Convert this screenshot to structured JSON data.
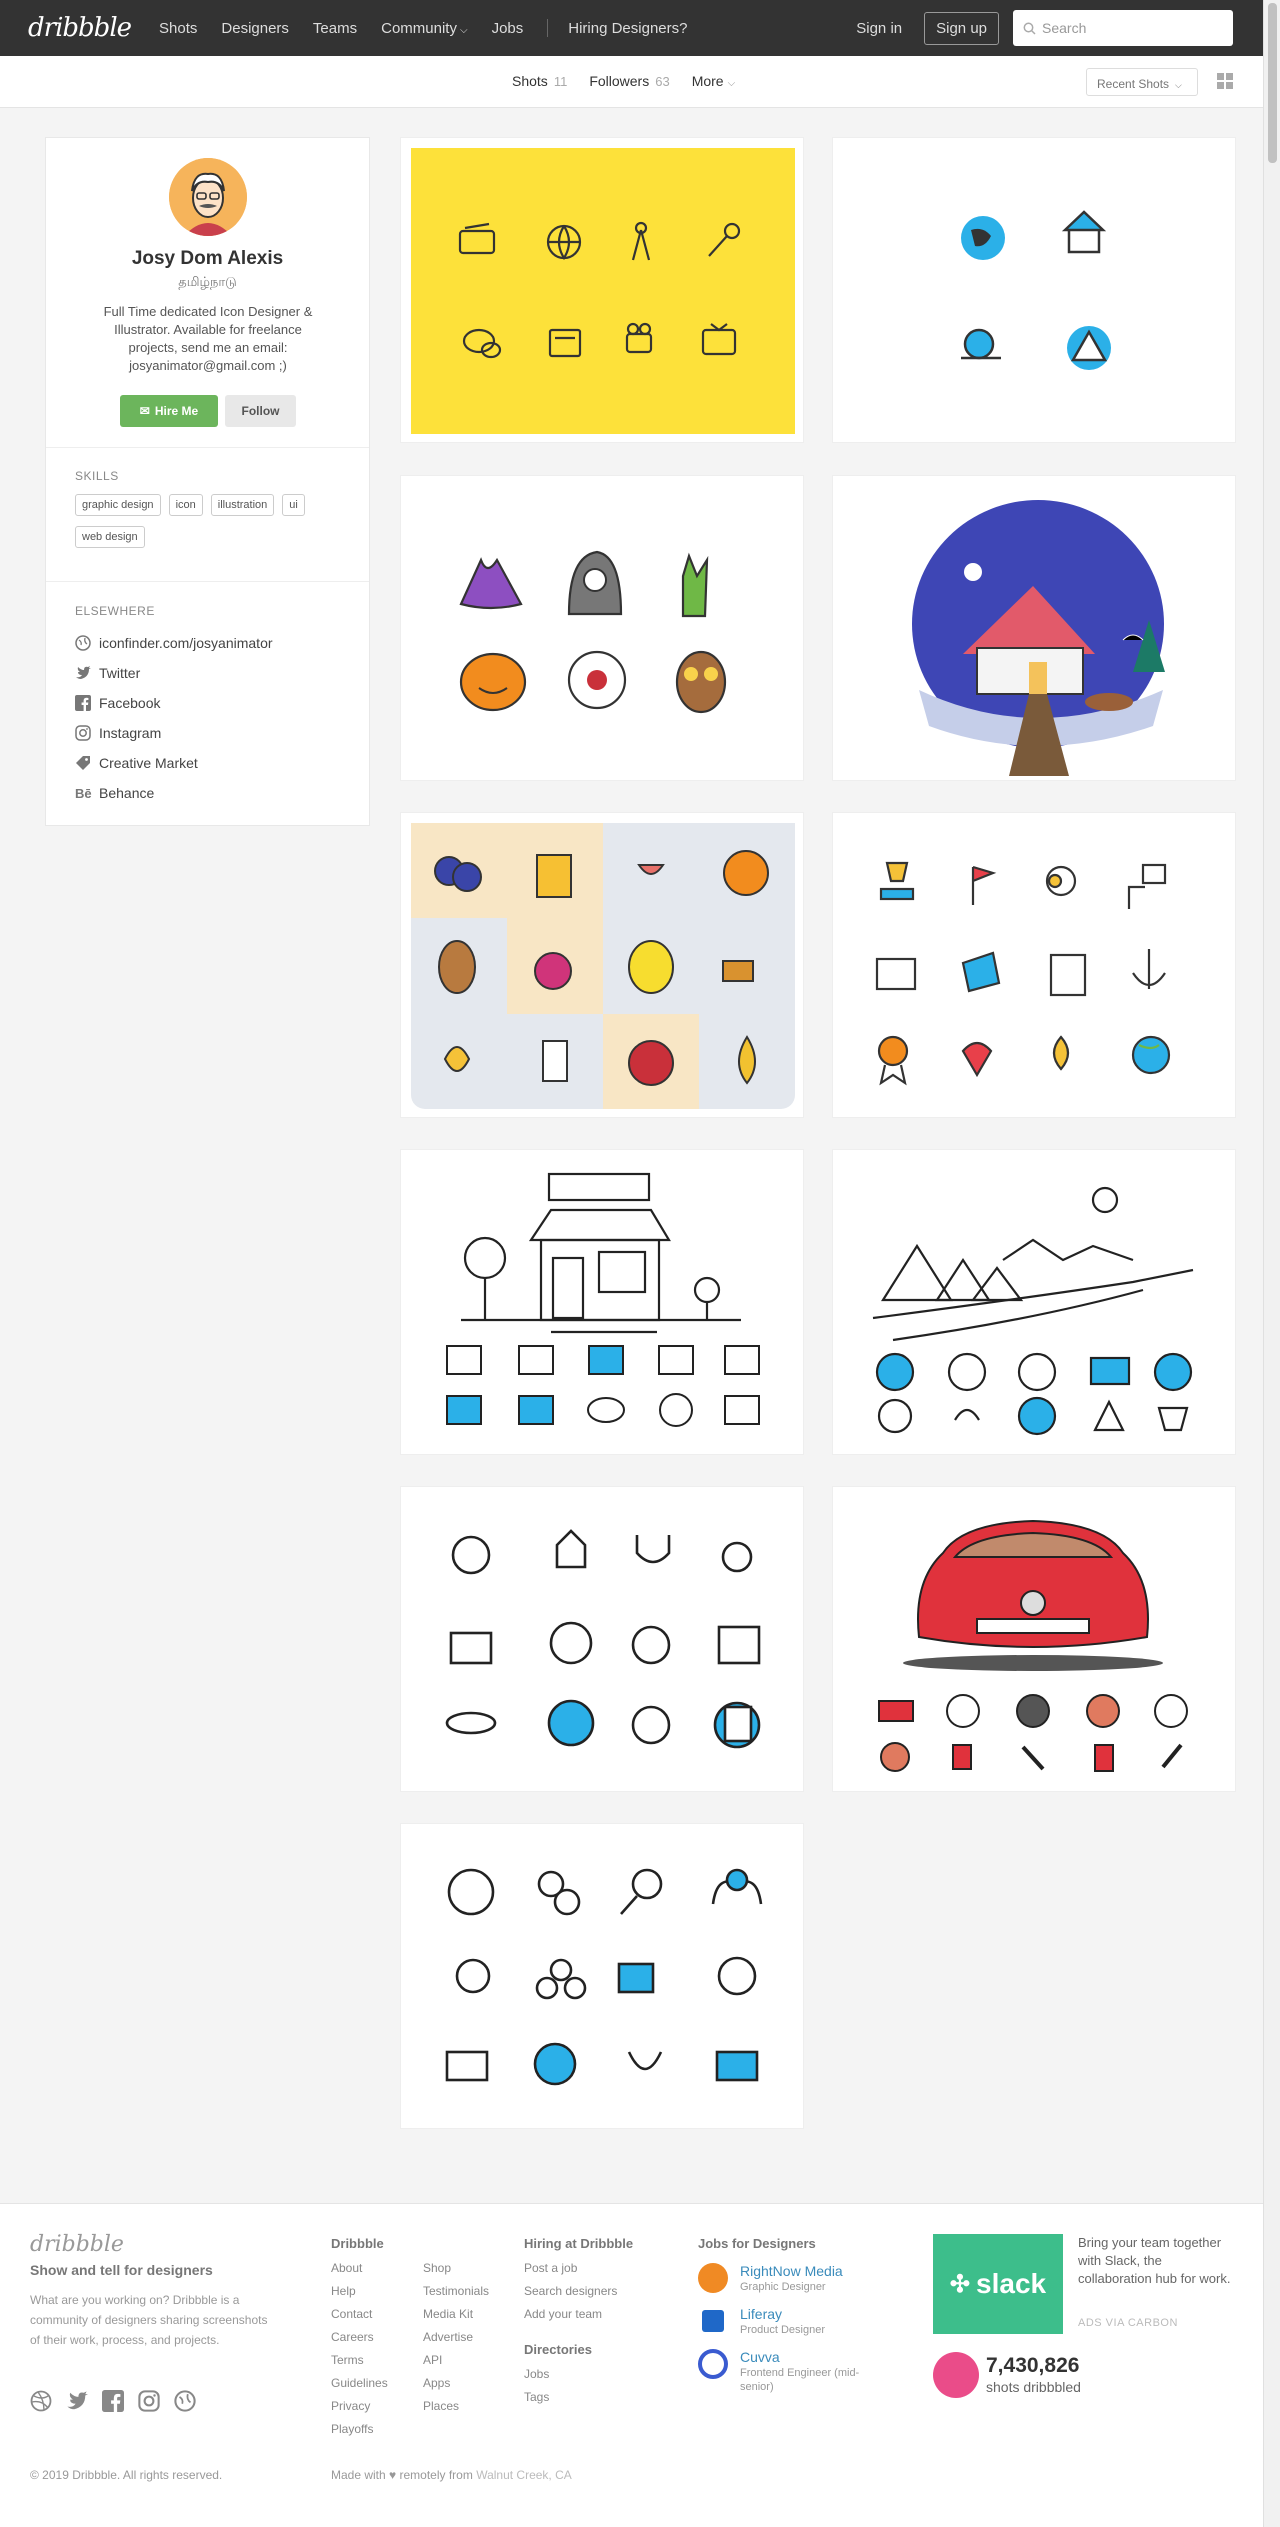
{
  "header": {
    "logo": "dribbble",
    "nav": [
      "Shots",
      "Designers",
      "Teams",
      "Community",
      "Jobs"
    ],
    "hiring": "Hiring Designers?",
    "signin": "Sign in",
    "signup": "Sign up",
    "search_placeholder": "Search"
  },
  "subnav": {
    "tabs": [
      {
        "label": "Shots",
        "count": "11"
      },
      {
        "label": "Followers",
        "count": "63"
      },
      {
        "label": "More",
        "count": ""
      }
    ],
    "sort": "Recent Shots"
  },
  "profile": {
    "name": "Josy Dom Alexis",
    "location": "தமிழ்நாடு",
    "bio": "Full Time dedicated Icon Designer & Illustrator. Available for freelance projects, send me an email: josyanimator@gmail.com ;)",
    "hire": "Hire Me",
    "follow": "Follow",
    "skills_heading": "SKILLS",
    "skills": [
      "graphic design",
      "icon",
      "illustration",
      "ui",
      "web design"
    ],
    "elsewhere_heading": "ELSEWHERE",
    "links": [
      {
        "label": "iconfinder.com/josyanimator",
        "icon": "globe-icon"
      },
      {
        "label": "Twitter",
        "icon": "twitter-icon"
      },
      {
        "label": "Facebook",
        "icon": "facebook-icon"
      },
      {
        "label": "Instagram",
        "icon": "instagram-icon"
      },
      {
        "label": "Creative Market",
        "icon": "tag-icon"
      },
      {
        "label": "Behance",
        "icon": "behance-icon"
      }
    ]
  },
  "shots": [
    {
      "name": "media-icons",
      "bg": "#fde13a"
    },
    {
      "name": "nature-icons",
      "bg": "#ffffff"
    },
    {
      "name": "halloween-icons",
      "bg": "#ffffff"
    },
    {
      "name": "winter-house-illustration",
      "bg": "#ffffff"
    },
    {
      "name": "food-icons",
      "bg": "#ffffff"
    },
    {
      "name": "business-icons",
      "bg": "#ffffff"
    },
    {
      "name": "shop-line-illustration",
      "bg": "#ffffff"
    },
    {
      "name": "landscape-line-illustration",
      "bg": "#ffffff"
    },
    {
      "name": "education-icons",
      "bg": "#ffffff"
    },
    {
      "name": "car-illustration",
      "bg": "#ffffff"
    },
    {
      "name": "finance-icons",
      "bg": "#ffffff"
    }
  ],
  "footer": {
    "logo": "dribbble",
    "tagline": "Show and tell for designers",
    "desc": "What are you working on? Dribbble is a community of designers sharing screenshots of their work, process, and projects.",
    "col1_heading": "Dribbble",
    "col1a": [
      "About",
      "Help",
      "Contact",
      "Careers",
      "Terms",
      "Guidelines",
      "Privacy",
      "Playoffs"
    ],
    "col1b": [
      "Shop",
      "Testimonials",
      "Media Kit",
      "Advertise",
      "API",
      "Apps",
      "Places"
    ],
    "col2_heading": "Hiring at Dribbble",
    "col2": [
      "Post a job",
      "Search designers",
      "Add your team"
    ],
    "col3_heading": "Directories",
    "col3": [
      "Jobs",
      "Tags"
    ],
    "jobs_heading": "Jobs for Designers",
    "jobs": [
      {
        "company": "RightNow Media",
        "role": "Graphic Designer",
        "color": "#f08a24"
      },
      {
        "company": "Liferay",
        "role": "Product Designer",
        "color": "#1f68c8"
      },
      {
        "company": "Cuvva",
        "role": "Frontend Engineer (mid-senior)",
        "color": "#3a5bd0"
      }
    ],
    "ad_brand": "slack",
    "ad_text": "Bring your team together with Slack, the collaboration hub for work.",
    "ads_via": "ADS VIA CARBON",
    "shots_count": "7,430,826",
    "shots_label": "shots dribbbled",
    "copyright": "© 2019 Dribbble. All rights reserved.",
    "made_with": "Made with ♥ remotely from",
    "made_place": "Walnut Creek, CA"
  }
}
